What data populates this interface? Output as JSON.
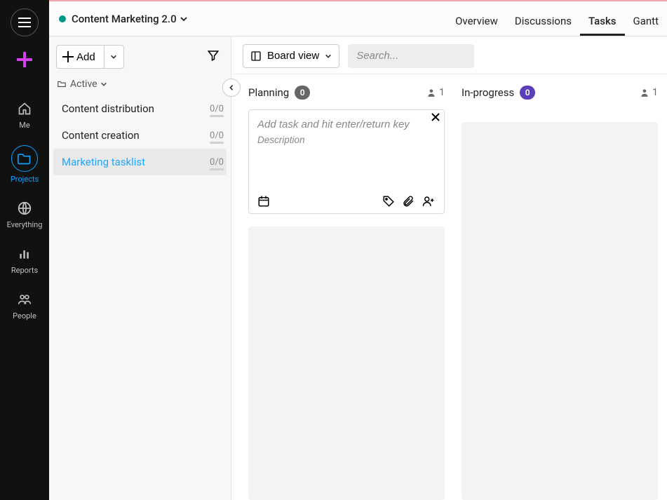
{
  "project": {
    "title": "Content Marketing 2.0"
  },
  "topnav": {
    "overview": "Overview",
    "discussions": "Discussions",
    "tasks": "Tasks",
    "gantt": "Gantt"
  },
  "rail": {
    "me": "Me",
    "projects": "Projects",
    "everything": "Everything",
    "reports": "Reports",
    "people": "People"
  },
  "leftpanel": {
    "add_label": "Add",
    "folder_label": "Active",
    "items": [
      {
        "label": "Content distribution",
        "count": "0/0"
      },
      {
        "label": "Content creation",
        "count": "0/0"
      },
      {
        "label": "Marketing tasklist",
        "count": "0/0"
      }
    ]
  },
  "board": {
    "view_label": "Board view",
    "search_placeholder": "Search...",
    "columns": [
      {
        "title": "Planning",
        "badge": "0",
        "assignees": "1",
        "badge_style": "grey"
      },
      {
        "title": "In-progress",
        "badge": "0",
        "assignees": "1",
        "badge_style": "purple"
      }
    ],
    "new_card": {
      "title_placeholder": "Add task and hit enter/return key",
      "desc_placeholder": "Description"
    }
  }
}
